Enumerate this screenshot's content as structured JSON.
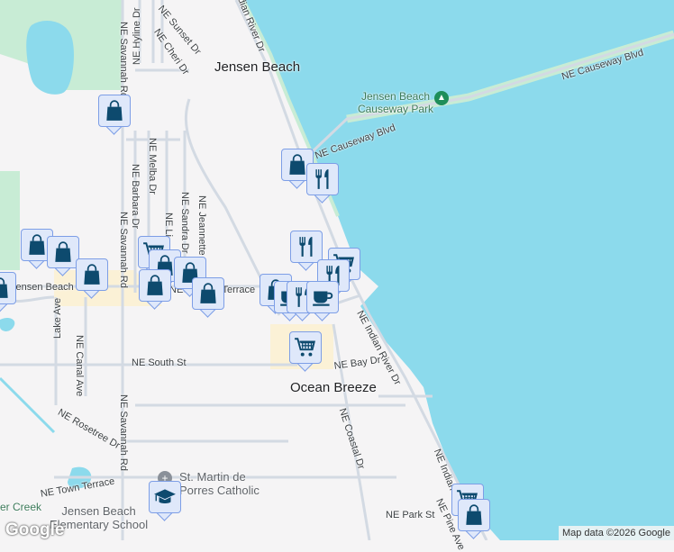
{
  "map": {
    "towns": [
      "Jensen Beach",
      "Ocean Breeze"
    ],
    "park": "Jensen Beach Causeway Park",
    "pois": [
      "St. Martin de",
      "Porres Catholic",
      "Jensen Beach",
      "Elementary School"
    ],
    "creek": "er Creek",
    "streets": {
      "indian_river_top": "NE Indian River Dr",
      "causeway_blvd_east": "NE Causeway Blvd",
      "causeway_blvd_west": "NE Causeway Blvd",
      "sunset": "NE Sunset Dr",
      "cheri": "NE Cheri Dr",
      "hyline": "NE Hyline Dr",
      "savannah_top": "NE Savannah Rd",
      "savannah_mid": "NE Savannah Rd",
      "savannah_low": "NE Savannah Rd",
      "melba": "NE Melba Dr",
      "barbara": "NE Barbara Dr",
      "lina": "NE Li",
      "sandra": "NE Sandra Dr",
      "jeannette": "NE Jeannette",
      "jensen_beach_blvd": "Jensen Beach Blvd",
      "sunrise_terrace": "NE Sunrise Terrace",
      "lake_ave": "Lake Ave",
      "canal_ave": "NE Canal Ave",
      "south_st": "NE South St",
      "bay_dr": "NE Bay Dr",
      "indian_river_mid": "NE Indian River Dr",
      "indian_river_low": "NE Indian",
      "coastal": "NE Coastal Dr",
      "rosetree": "NE Rosetree Dr",
      "town_terrace": "NE Town Terrace",
      "park_st": "NE Park St",
      "pine_ave": "NE Pine Ave"
    },
    "logo": "Google",
    "attribution": "Map data ©2026 Google"
  },
  "colors": {
    "water": "#8cdaec",
    "land": "#f5f4f5",
    "park": "#c8ecd5",
    "marker_bg": "#dfe8fa",
    "icon": "#0d4a6e"
  }
}
